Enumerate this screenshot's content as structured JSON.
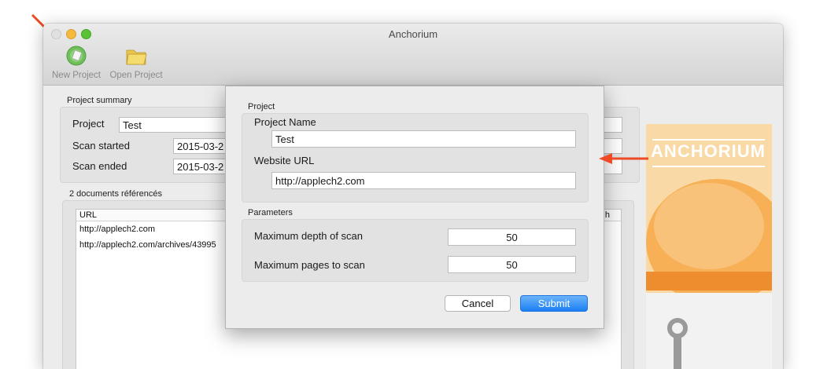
{
  "window": {
    "title": "Anchorium"
  },
  "toolbar": {
    "new_project": "New Project",
    "open_project": "Open Project"
  },
  "summary": {
    "group_label": "Project summary",
    "project_label": "Project",
    "project_value": "Test",
    "scan_started_label": "Scan started",
    "scan_started_value": "2015-03-2",
    "scan_ended_label": "Scan ended",
    "scan_ended_value": "2015-03-2"
  },
  "documents": {
    "group_label": "2 documents référencés",
    "column_url": "URL",
    "column_right": "h",
    "rows": [
      "http://applech2.com",
      "http://applech2.com/archives/43995"
    ]
  },
  "banner": {
    "text": "ANCHORIUM"
  },
  "sheet": {
    "project_group_label": "Project",
    "project_name_label": "Project Name",
    "project_name_value": "Test",
    "website_url_label": "Website URL",
    "website_url_value": "http://applech2.com",
    "parameters_group_label": "Parameters",
    "max_depth_label": "Maximum depth of scan",
    "max_depth_value": "50",
    "max_pages_label": "Maximum pages to scan",
    "max_pages_value": "50",
    "cancel_label": "Cancel",
    "submit_label": "Submit"
  },
  "colors": {
    "accent_blue": "#1b7ff3",
    "annotation_red": "#ee4a25",
    "banner_orange": "#f7b055",
    "banner_bg": "#f9d9a6"
  }
}
